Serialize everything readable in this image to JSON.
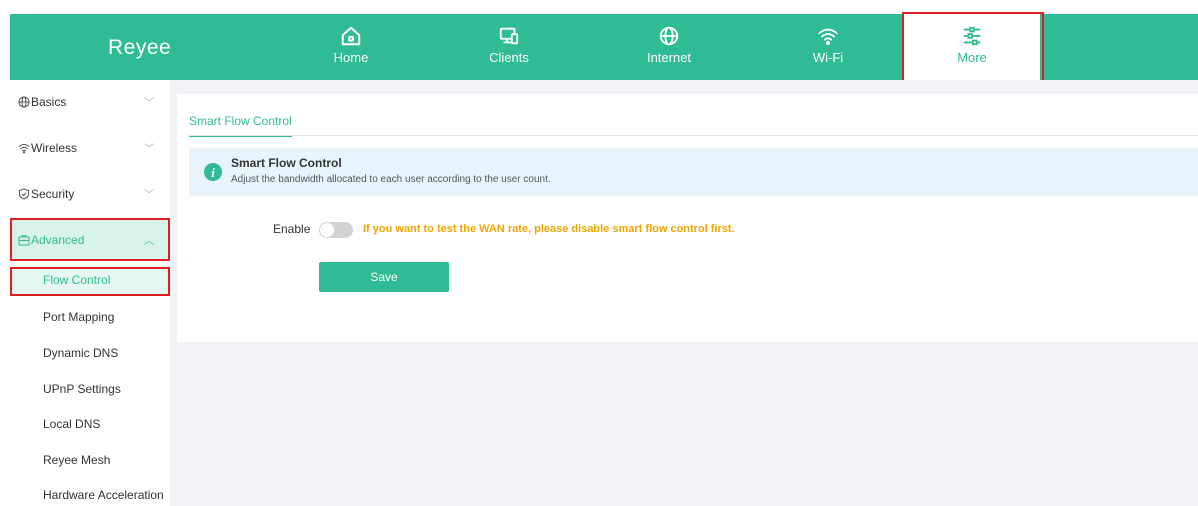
{
  "brand": {
    "logo": "Reyee",
    "accent": "#2fbb93",
    "highlight": "#e02020"
  },
  "topnav": {
    "items": [
      {
        "label": "Home",
        "icon": "home-icon"
      },
      {
        "label": "Clients",
        "icon": "devices-icon"
      },
      {
        "label": "Internet",
        "icon": "globe-icon"
      },
      {
        "label": "Wi-Fi",
        "icon": "wifi-icon"
      },
      {
        "label": "More",
        "icon": "sliders-icon",
        "active": true
      }
    ]
  },
  "sidebar": {
    "groups": [
      {
        "label": "Basics",
        "icon": "globe-icon",
        "chevron": "﹀"
      },
      {
        "label": "Wireless",
        "icon": "wifi-icon",
        "chevron": "﹀"
      },
      {
        "label": "Security",
        "icon": "shield-icon",
        "chevron": "﹀"
      },
      {
        "label": "Advanced",
        "icon": "briefcase-icon",
        "chevron": "︿",
        "open": true
      }
    ],
    "subitems": [
      {
        "label": "Flow Control",
        "active": true
      },
      {
        "label": "Port Mapping"
      },
      {
        "label": "Dynamic DNS"
      },
      {
        "label": "UPnP Settings"
      },
      {
        "label": "Local DNS"
      },
      {
        "label": "Reyee Mesh"
      },
      {
        "label": "Hardware Acceleration"
      }
    ]
  },
  "main": {
    "tab": "Smart Flow Control",
    "info": {
      "title": "Smart Flow Control",
      "desc": "Adjust the bandwidth allocated to each user according to the user count.",
      "icon": "info-icon"
    },
    "enable_label": "Enable",
    "enable_state": "off",
    "warning": "If you want to test the WAN rate, please disable smart flow control first.",
    "save_label": "Save"
  }
}
